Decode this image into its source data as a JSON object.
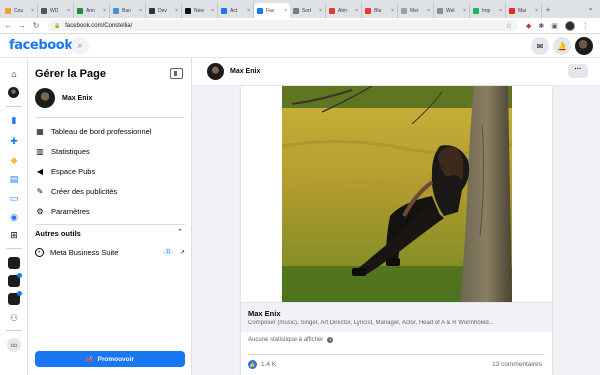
{
  "browser": {
    "tabs": [
      {
        "label": "Cou",
        "color": "#e8a33d"
      },
      {
        "label": "WD",
        "color": "#555555"
      },
      {
        "label": "Ann",
        "color": "#1e8e3e"
      },
      {
        "label": "Ban",
        "color": "#4a90d9"
      },
      {
        "label": "Dev",
        "color": "#333333"
      },
      {
        "label": "New",
        "color": "#111111"
      },
      {
        "label": "Act",
        "color": "#1877f2"
      },
      {
        "label": "Fac",
        "color": "#1877f2",
        "active": true
      },
      {
        "label": "Sort",
        "color": "#7a7a7a"
      },
      {
        "label": "Atm",
        "color": "#e53935"
      },
      {
        "label": "Bla",
        "color": "#e53935"
      },
      {
        "label": "Mer",
        "color": "#9e9e9e"
      },
      {
        "label": "Wel",
        "color": "#8d8d8d"
      },
      {
        "label": "Imp",
        "color": "#1db954"
      },
      {
        "label": "Mai",
        "color": "#d93025"
      }
    ],
    "url": "facebook.com/Constellia/"
  },
  "fb": {
    "logo": "facebook"
  },
  "panel": {
    "title": "Gérer la Page",
    "page_name": "Max Enix",
    "menu": [
      {
        "label": "Tableau de bord professionnel",
        "icon": "dashboard-icon"
      },
      {
        "label": "Statistiques",
        "icon": "stats-icon"
      },
      {
        "label": "Espace Pubs",
        "icon": "ads-icon"
      },
      {
        "label": "Créer des publicités",
        "icon": "pencil-icon"
      },
      {
        "label": "Paramètres",
        "icon": "gear-icon"
      }
    ],
    "tools_title": "Autres outils",
    "mbs_label": "Meta Business Suite",
    "mbs_badge": "11",
    "promote_label": "Promouvoir"
  },
  "main": {
    "header_name": "Max Enix",
    "post_title": "Max Enix",
    "post_subtitle": "Composer (music), Singer, Art Director, Lyricist, Manager, Actor, Head of A & R Wormholed...",
    "stats_text": "Aucune statistique à afficher",
    "likes": "1,4 K",
    "comments": "13 commentaires"
  },
  "colors": {
    "brand": "#1877f2"
  }
}
